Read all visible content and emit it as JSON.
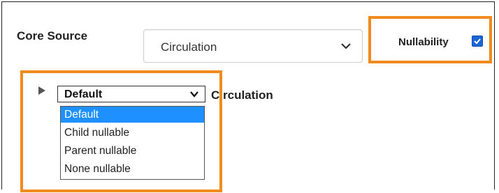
{
  "core_source": {
    "label": "Core Source",
    "selected": "Circulation"
  },
  "nullability": {
    "label": "Nullability",
    "checked": true
  },
  "relation": {
    "nullability_select": {
      "selected": "Default",
      "options": [
        "Default",
        "Child nullable",
        "Parent nullable",
        "None nullable"
      ]
    },
    "label": "Circulation"
  },
  "colors": {
    "highlight_border": "#f08c1e",
    "selected_option": "#1e90ff",
    "checkbox": "#1a66d4"
  }
}
